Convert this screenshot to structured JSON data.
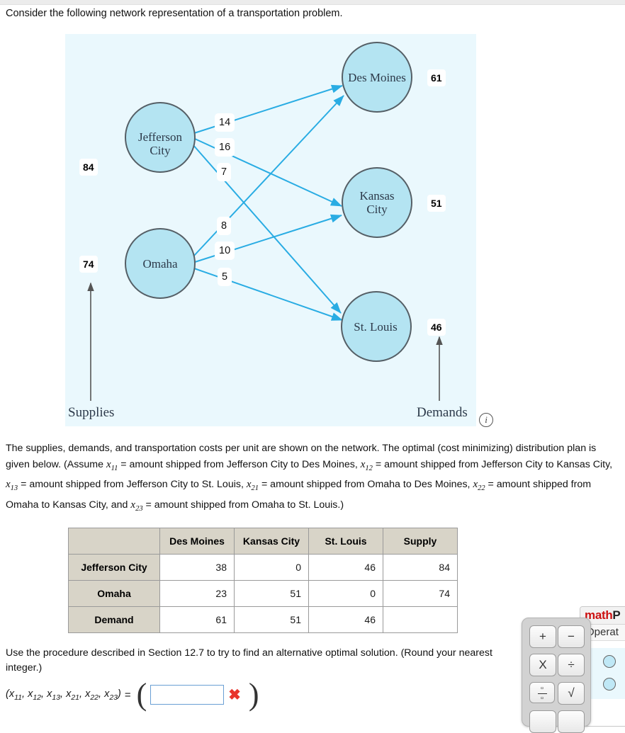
{
  "intro": "Consider the following network representation of a transportation problem.",
  "diagram": {
    "sources": [
      {
        "name": "Jefferson City",
        "line1": "Jefferson",
        "line2": "City",
        "supply": "84"
      },
      {
        "name": "Omaha",
        "line1": "Omaha",
        "line2": "",
        "supply": "74"
      }
    ],
    "destinations": [
      {
        "name": "Des Moines",
        "line1": "Des Moines",
        "line2": "",
        "demand": "61"
      },
      {
        "name": "Kansas City",
        "line1": "Kansas",
        "line2": "City",
        "demand": "51"
      },
      {
        "name": "St. Louis",
        "line1": "St. Louis",
        "line2": "",
        "demand": "46"
      }
    ],
    "arc_costs": [
      {
        "from": "Jefferson City",
        "to": "Des Moines",
        "cost": "14"
      },
      {
        "from": "Jefferson City",
        "to": "Kansas City",
        "cost": "16"
      },
      {
        "from": "Jefferson City",
        "to": "St. Louis",
        "cost": "7"
      },
      {
        "from": "Omaha",
        "to": "Des Moines",
        "cost": "8"
      },
      {
        "from": "Omaha",
        "to": "Kansas City",
        "cost": "10"
      },
      {
        "from": "Omaha",
        "to": "St. Louis",
        "cost": "5"
      }
    ],
    "supplies_label": "Supplies",
    "demands_label": "Demands",
    "info_icon": "i",
    "colors": {
      "panel_bg": "#eaf8fd",
      "node_fill": "#b4e4f2",
      "node_stroke": "#555f66",
      "arc": "#29ace3",
      "axis_arrow": "#555555"
    }
  },
  "prose": {
    "p1_a": "The supplies, demands, and transportation costs per unit are shown on the network. The optimal (cost minimizing) distribution plan is given below. (Assume ",
    "v11": "x",
    "v11s": "11",
    "p1_b": " = amount shipped from Jefferson City to Des Moines, ",
    "v12": "x",
    "v12s": "12",
    "p1_c": " = amount shipped from Jefferson City to Kansas City, ",
    "v13": "x",
    "v13s": "13",
    "p1_d": " = amount shipped from Jefferson City to St. Louis, ",
    "v21": "x",
    "v21s": "21",
    "p1_e": " = amount shipped from Omaha to Des Moines, ",
    "v22": "x",
    "v22s": "22",
    "p1_f": " = amount shipped from Omaha to Kansas City, and ",
    "v23": "x",
    "v23s": "23",
    "p1_g": " = amount shipped from Omaha to St. Louis.)"
  },
  "table": {
    "corner": "",
    "columns": [
      "Des Moines",
      "Kansas City",
      "St. Louis",
      "Supply"
    ],
    "rows": [
      {
        "header": "Jefferson City",
        "cells": [
          "38",
          "0",
          "46",
          "84"
        ]
      },
      {
        "header": "Omaha",
        "cells": [
          "23",
          "51",
          "0",
          "74"
        ]
      },
      {
        "header": "Demand",
        "cells": [
          "61",
          "51",
          "46",
          ""
        ]
      }
    ]
  },
  "question2": {
    "text": "Use the procedure described in Section 12.7 to try to find an alternative optimal solution. (Round your nearest integer.)",
    "answer_label_x": "x",
    "answer_subs": [
      "11",
      "12",
      "13",
      "21",
      "22",
      "23"
    ],
    "equals": "=",
    "input_value": "",
    "input_placeholder": "",
    "wrong_mark": "✖",
    "open_paren": "(",
    "close_paren": ")"
  },
  "mathpad": {
    "title_red": "math",
    "title_dark": "P",
    "tab_label": "Operat",
    "keys": [
      "+",
      "−",
      "X",
      "÷",
      "fraction",
      "√"
    ],
    "sqrt_glyph": "√",
    "plus": "+",
    "minus": "−",
    "times": "X",
    "divide": "÷"
  }
}
